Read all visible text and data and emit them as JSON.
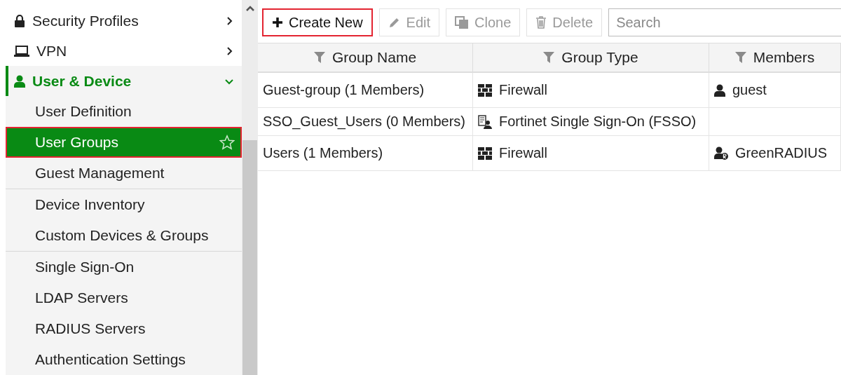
{
  "sidebar": {
    "items": [
      {
        "label": "Security Profiles",
        "expanded": false,
        "selected": false
      },
      {
        "label": "VPN",
        "expanded": false,
        "selected": false
      },
      {
        "label": "User & Device",
        "expanded": true,
        "selected": true,
        "groups": [
          [
            {
              "label": "User Definition",
              "selected": false
            },
            {
              "label": "User Groups",
              "selected": true,
              "favorite": false
            },
            {
              "label": "Guest Management",
              "selected": false
            }
          ],
          [
            {
              "label": "Device Inventory",
              "selected": false
            },
            {
              "label": "Custom Devices & Groups",
              "selected": false
            }
          ],
          [
            {
              "label": "Single Sign-On",
              "selected": false
            },
            {
              "label": "LDAP Servers",
              "selected": false
            },
            {
              "label": "RADIUS Servers",
              "selected": false
            },
            {
              "label": "Authentication Settings",
              "selected": false
            }
          ]
        ]
      }
    ]
  },
  "toolbar": {
    "buttons": [
      {
        "label": "Create New",
        "kind": "create",
        "disabled": false,
        "highlighted": true
      },
      {
        "label": "Edit",
        "kind": "edit",
        "disabled": true,
        "highlighted": false
      },
      {
        "label": "Clone",
        "kind": "clone",
        "disabled": true,
        "highlighted": false
      },
      {
        "label": "Delete",
        "kind": "delete",
        "disabled": true,
        "highlighted": false
      }
    ],
    "search": {
      "placeholder": "Search"
    }
  },
  "table": {
    "columns": [
      "Group Name",
      "Group Type",
      "Members"
    ],
    "rows": [
      {
        "name": "Guest-group (1 Members)",
        "type": {
          "kind": "firewall",
          "text": "Firewall"
        },
        "members": [
          {
            "kind": "user",
            "text": "guest"
          }
        ]
      },
      {
        "name": "SSO_Guest_Users (0 Members)",
        "type": {
          "kind": "fsso",
          "text": "Fortinet Single Sign-On (FSSO)"
        },
        "members": []
      },
      {
        "name": "Users (1 Members)",
        "type": {
          "kind": "firewall",
          "text": "Firewall"
        },
        "members": [
          {
            "kind": "radius",
            "text": "GreenRADIUS"
          }
        ]
      }
    ]
  }
}
